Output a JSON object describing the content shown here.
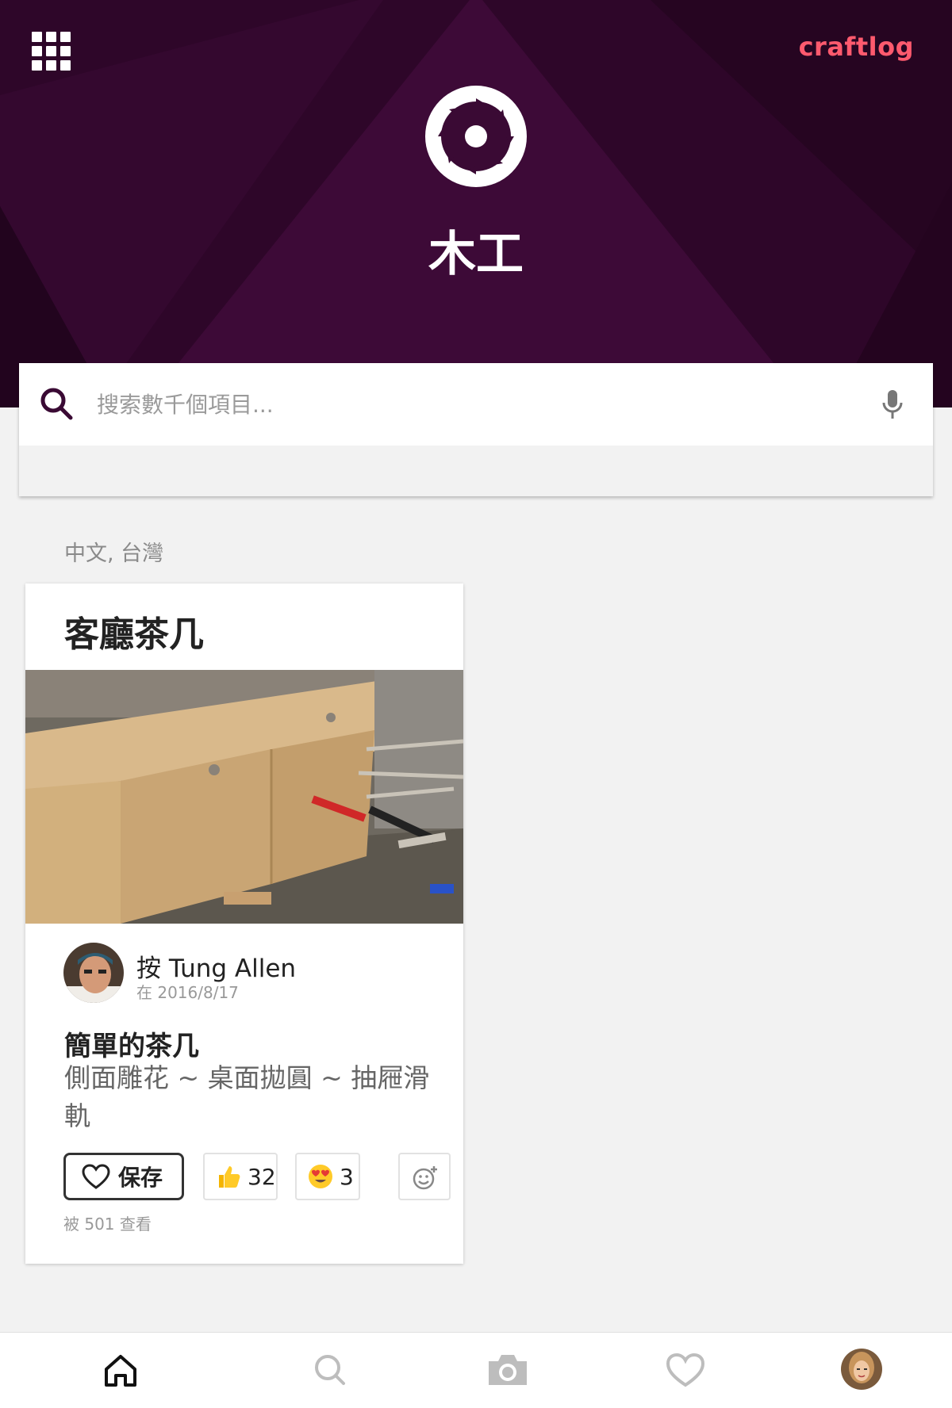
{
  "header": {
    "brand": "craftlog",
    "category_title": "木工",
    "category_icon": "saw-blade-icon",
    "menu_icon": "grid-menu-icon"
  },
  "search": {
    "placeholder": "搜索數千個項目..."
  },
  "locale_label": "中文, 台灣",
  "card": {
    "title": "客廳茶几",
    "image_alt": "Wooden coffee table with drawers",
    "author_line": "按 Tung Allen",
    "date_line": "在 2016/8/17",
    "post_title": "簡單的茶几",
    "post_description": "側面雕花 ~ 桌面拋圓 ~ 抽屜滑軌",
    "save_label": "保存",
    "reactions": [
      {
        "icon": "thumbs-up-icon",
        "count": "32"
      },
      {
        "icon": "heart-eyes-icon",
        "count": "3"
      }
    ],
    "views_line": "被 501 查看"
  },
  "colors": {
    "header_bg": "#3a0a34",
    "brand": "#ff5a6e",
    "accent": "#3a0a34"
  },
  "bottom_nav": [
    {
      "name": "home",
      "icon": "home-icon",
      "active": true
    },
    {
      "name": "search",
      "icon": "search-icon",
      "active": false
    },
    {
      "name": "camera",
      "icon": "camera-icon",
      "active": false
    },
    {
      "name": "favorites",
      "icon": "heart-icon",
      "active": false
    },
    {
      "name": "profile",
      "icon": "avatar",
      "active": false
    }
  ]
}
